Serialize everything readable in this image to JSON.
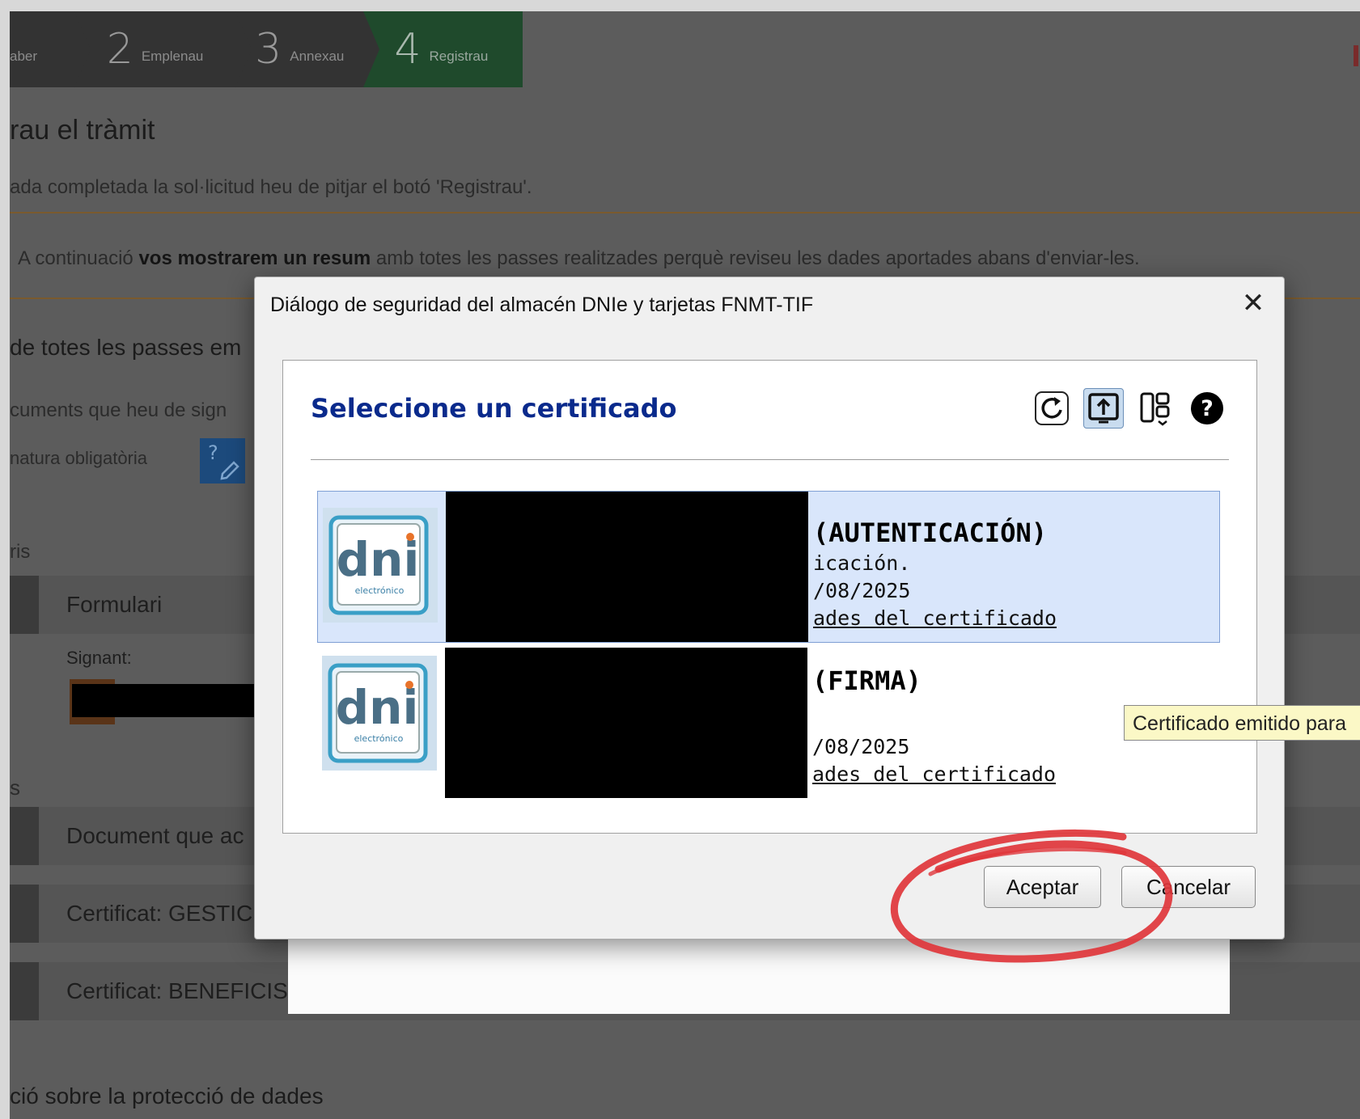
{
  "steps": [
    {
      "num": "",
      "label": "aber"
    },
    {
      "num": "2",
      "label": "Emplenau"
    },
    {
      "num": "3",
      "label": "Annexau"
    },
    {
      "num": "4",
      "label": "Registrau"
    }
  ],
  "page": {
    "title": "rau el tràmit",
    "subtitle": "ada completada la sol·licitud heu de pitjar el botó 'Registrau'.",
    "info_pre": "A continuació ",
    "info_bold": "vos mostrarem un resum",
    "info_post": " amb totes les passes realitzades perquè reviseu les dades aportades abans d'enviar-les.",
    "section_heading": "de totes les passes em",
    "docs_text": "cuments que heu de sign",
    "mandatory_sig": "natura obligatòria",
    "sign_icon_glyph": "?",
    "forms_heading": "ris",
    "row_form": "Formulari",
    "signer_label": "Signant:",
    "s_heading": "s",
    "row_doc": "Document que ac",
    "row_cert1": "Certificat: GESTIC",
    "row_cert2": "Certificat: BENEFICIS",
    "protection_heading": "ció sobre la protecció de dades"
  },
  "dialog": {
    "title": "Diálogo de seguridad del almacén DNIe y tarjetas FNMT-TIF",
    "close_glyph": "✕",
    "panel_title": "Seleccione un certificado",
    "tools": [
      "refresh-icon",
      "import-icon",
      "view-mode-icon",
      "help-icon"
    ],
    "certificates": [
      {
        "name": "(AUTENTICACIÓN)",
        "line1": "icación.",
        "line2": "/08/2025",
        "link": "ades del certificado",
        "logo_text": "dni",
        "logo_sub": "electrónico",
        "selected": true
      },
      {
        "name": "(FIRMA)",
        "line1": "",
        "line2": "/08/2025",
        "link": "ades del certificado",
        "logo_text": "dni",
        "logo_sub": "electrónico",
        "selected": false
      }
    ],
    "accept_label": "Aceptar",
    "cancel_label": "Cancelar",
    "tooltip": "Certificado emitido para"
  },
  "colors": {
    "panel_title": "#0a2a8c",
    "selected_row": "#d9e6fb",
    "annotation": "#e0363b",
    "step_active": "#1f4a2c"
  }
}
